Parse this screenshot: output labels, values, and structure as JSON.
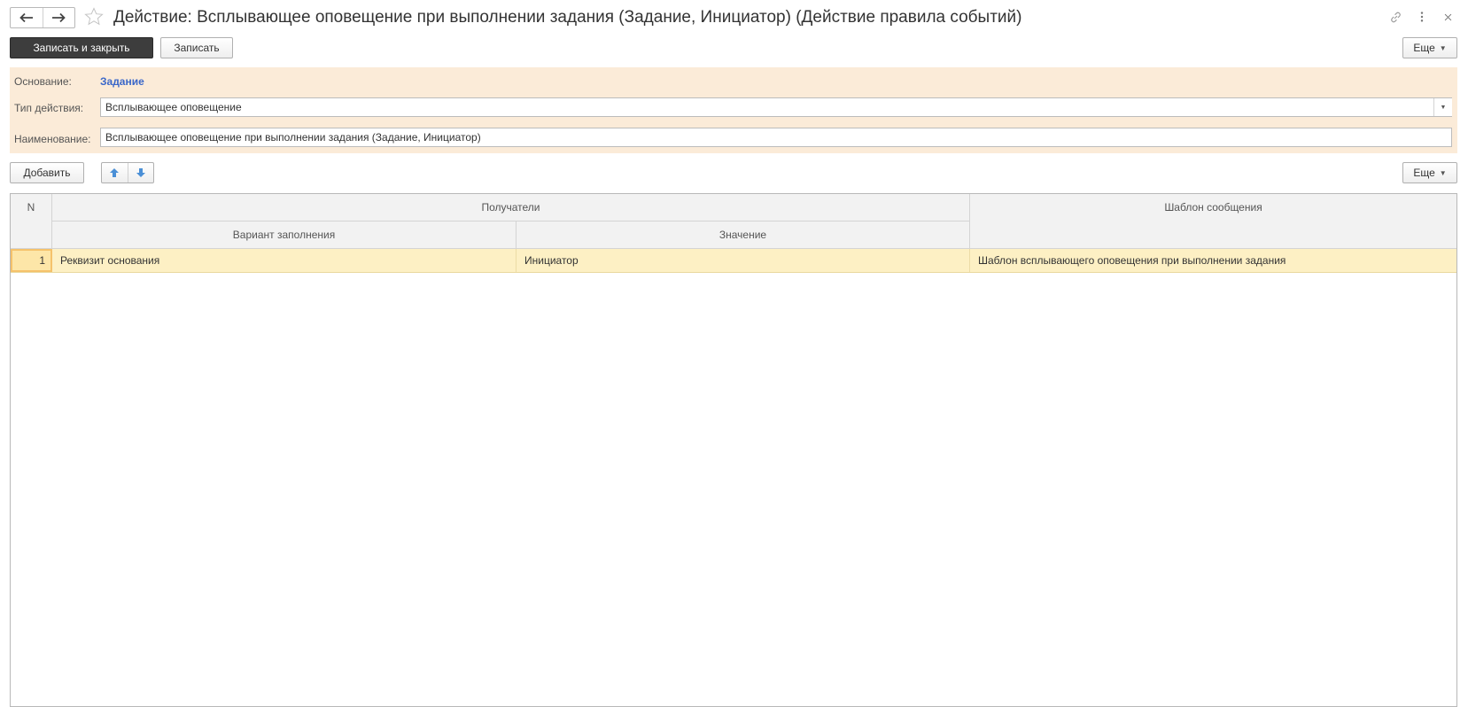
{
  "window": {
    "title": "Действие: Всплывающее оповещение при выполнении задания (Задание, Инициатор) (Действие правила событий)",
    "back_icon": "arrow-left-icon",
    "forward_icon": "arrow-right-icon",
    "favorite_icon": "star-icon",
    "link_icon": "link-icon",
    "menu_icon": "more-vertical-icon",
    "close_icon": "close-icon"
  },
  "toolbar": {
    "save_close_label": "Записать и закрыть",
    "save_label": "Записать",
    "more_label": "Еще"
  },
  "form": {
    "basis_label": "Основание:",
    "basis_value": "Задание",
    "action_type_label": "Тип действия:",
    "action_type_value": "Всплывающее оповещение",
    "name_label": "Наименование:",
    "name_value": "Всплывающее оповещение при выполнении задания (Задание, Инициатор)"
  },
  "table_toolbar": {
    "add_label": "Добавить",
    "move_up_icon": "arrow-up-icon",
    "move_down_icon": "arrow-down-icon",
    "more_label": "Еще"
  },
  "table": {
    "headers": {
      "n": "N",
      "recipients": "Получатели",
      "fill_variant": "Вариант заполнения",
      "value": "Значение",
      "template": "Шаблон сообщения"
    },
    "rows": [
      {
        "n": "1",
        "fill_variant": "Реквизит основания",
        "value": "Инициатор",
        "template": "Шаблон всплывающего оповещения при выполнении задания"
      }
    ]
  },
  "colors": {
    "header_panel_bg": "#fbebd8",
    "link": "#3a67c9",
    "selected_row_bg": "#fdf0c4",
    "arrow_blue": "#4a8fd6",
    "primary_button_bg": "#3d3d3d"
  }
}
